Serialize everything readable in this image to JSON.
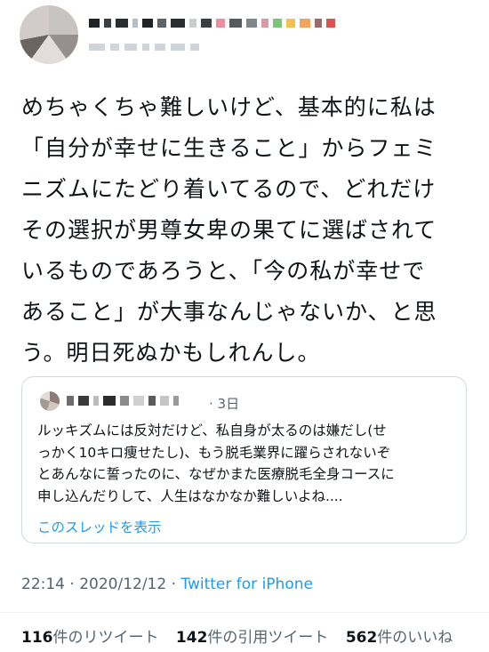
{
  "tweet": {
    "text": "めちゃくちゃ難しいけど、基本的に私は\n「自分が幸せに生きること」からフェミ\nニズムにたどり着いてるので、どれだけ\nその選択が男尊女卑の果てに選ばされて\nいるものであろうと、「今の私が幸せで\nあること」が大事なんじゃないか、と思\nう。明日死ぬかもしれんし。"
  },
  "quoted": {
    "date": "· 3日",
    "text": "ルッキズムには反対だけど、私自身が太るのは嫌だし(せ\nっかく10キロ痩せたし)、もう脱毛業界に躍らされないぞ\nとあんなに誓ったのに、なぜかまた医療脱毛全身コースに\n申し込んだりして、人生はなかなか難しいよね....",
    "thread_link": "このスレッドを表示"
  },
  "meta": {
    "time_date": "22:14 · 2020/12/12 · ",
    "source": "Twitter for iPhone"
  },
  "stats": {
    "retweets": "116",
    "retweets_label": "件のリツイート",
    "quotes": "142",
    "quotes_label": "件の引用ツイート",
    "likes": "562",
    "likes_label": "件のいいね"
  },
  "colors": {
    "accent": "#1d9bf0",
    "secondary_text": "#536471",
    "border": "#cfd9de"
  }
}
